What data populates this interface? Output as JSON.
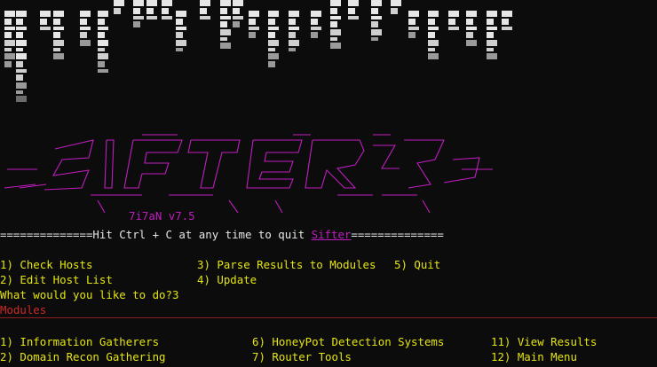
{
  "banner": {
    "description_icon": "glitch-banner-art"
  },
  "logo": {
    "version_label": "7i7aN  v7.5"
  },
  "quit_hint": {
    "prefix": "==============Hit Ctrl + C at any time to quit ",
    "app": "Sifter",
    "suffix": "=============="
  },
  "main_menu": {
    "items": [
      "1) Check Hosts",
      "2) Edit Host List",
      "3) Parse Results to Modules",
      "4) Update",
      "5) Quit"
    ]
  },
  "prompt": {
    "question": "What would you like to do?3"
  },
  "modules": {
    "heading": "Modules",
    "items": [
      "1) Information Gatherers",
      "2) Domain Recon Gathering",
      "6) HoneyPot Detection Systems",
      "7) Router Tools",
      "11) View Results",
      "12) Main Menu"
    ]
  },
  "colors": {
    "background": "#0c0c0c",
    "menu_text": "#e5e510",
    "logo": "#c01dc0",
    "modules_heading": "#cd2a2a"
  }
}
